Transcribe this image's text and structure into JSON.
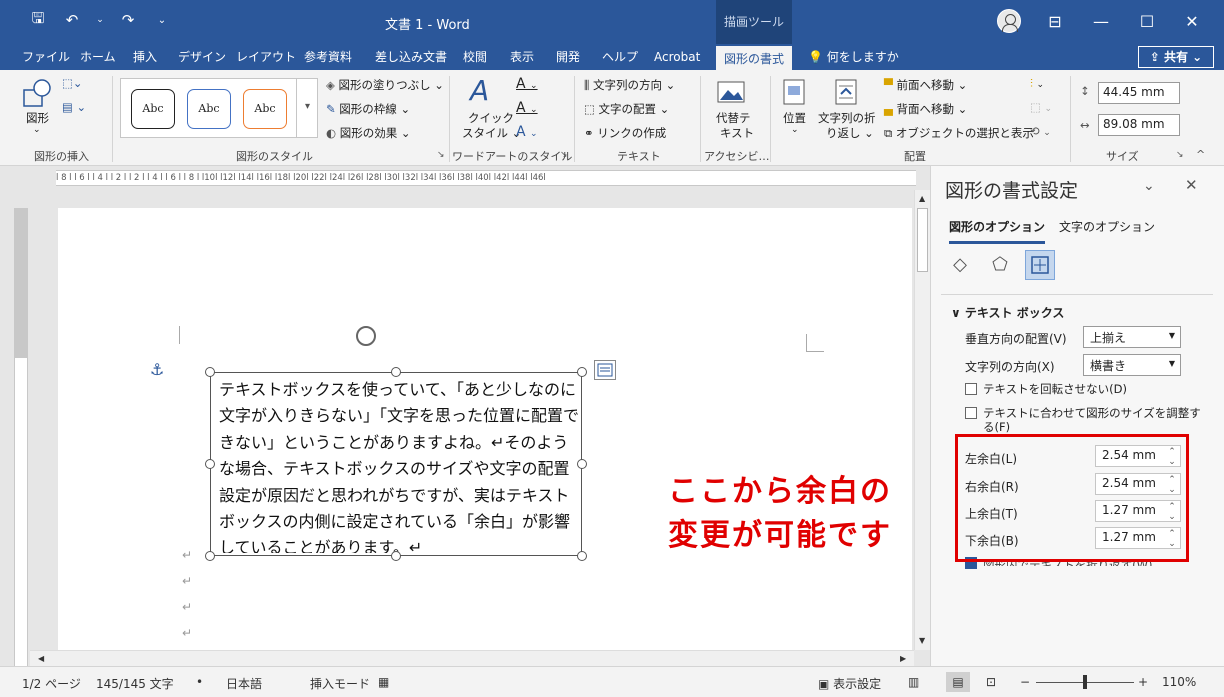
{
  "titlebar": {
    "doc_title": "文書 1  -  Word",
    "context_tab": "描画ツール",
    "icons": [
      "save-icon",
      "undo-icon",
      "redo-icon",
      "customize-qat-icon",
      "ribbon-display-icon"
    ],
    "colors": {
      "brand": "#2b579a"
    }
  },
  "tabs": {
    "items": [
      "ファイル",
      "ホーム",
      "挿入",
      "デザイン",
      "レイアウト",
      "参考資料",
      "差し込み文書",
      "校閲",
      "表示",
      "開発",
      "ヘルプ",
      "Acrobat",
      "図形の書式"
    ],
    "tell_me": "何をしますか",
    "share": "共有"
  },
  "ribbon": {
    "insert_shapes": {
      "shape_label": "図形",
      "group": "図形の挿入"
    },
    "shape_styles": {
      "samples": [
        "Abc",
        "Abc",
        "Abc"
      ],
      "fill": "図形の塗りつぶし",
      "outline": "図形の枠線",
      "effects": "図形の効果",
      "group": "図形のスタイル"
    },
    "wordart": {
      "quick_styles_line1": "クイック",
      "quick_styles_line2": "スタイル",
      "group": "ワードアートのスタイル"
    },
    "text": {
      "direction": "文字列の方向",
      "align": "文字の配置",
      "link": "リンクの作成",
      "group": "テキスト"
    },
    "accessibility": {
      "alt_text_line1": "代替テ",
      "alt_text_line2": "キスト",
      "group": "アクセシビ…"
    },
    "arrange": {
      "position": "位置",
      "wrap_line1": "文字列の折",
      "wrap_line2": "り返し",
      "bring_forward": "前面へ移動",
      "send_backward": "背面へ移動",
      "selection_pane": "オブジェクトの選択と表示",
      "group": "配置"
    },
    "size": {
      "height": "44.45 mm",
      "width": "89.08 mm",
      "group": "サイズ"
    }
  },
  "ruler": {
    "ticks": "l 8 l  l 6 l  l 4 l  l 2 l     l 2 l  l 4 l  l 6 l  l 8 l  l10l  l12l  l14l  l16l  l18l  l20l  l22l  l24l  l26l  l28l  l30l  l32l  l34l  l36l  l38l  l40l  l42l  l44l  l46l"
  },
  "document": {
    "textbox_text": "テキストボックスを使っていて、「あと少しなのに文字が入りきらない」「文字を思った位置に配置できない」ということがありますよね。↵そのような場合、テキストボックスのサイズや文字の配置設定が原因だと思われがちですが、実はテキストボックスの内側に設定されている「余白」が影響していることがあります。↵",
    "para_marks": [
      "↵",
      "↵",
      "↵",
      "↵"
    ],
    "annotation_line1": "ここから余白の",
    "annotation_line2": "変更が可能です"
  },
  "pane": {
    "title": "図形の書式設定",
    "tab_shape": "図形のオプション",
    "tab_text": "文字のオプション",
    "section": "テキスト ボックス",
    "vertical_align_label": "垂直方向の配置(V)",
    "vertical_align_value": "上揃え",
    "text_direction_label": "文字列の方向(X)",
    "text_direction_value": "横書き",
    "no_rotate_label": "テキストを回転させない(D)",
    "autofit_label": "テキストに合わせて図形のサイズを調整する(F)",
    "left_label": "左余白(L)",
    "left_value": "2.54 mm",
    "right_label": "右余白(R)",
    "right_value": "2.54 mm",
    "top_label": "上余白(T)",
    "top_value": "1.27 mm",
    "bottom_label": "下余白(B)",
    "bottom_value": "1.27 mm",
    "wrap_label": "図形内でテキストを折り返す(W)",
    "highlight_color": "#e00000"
  },
  "status": {
    "page": "1/2 ページ",
    "words": "145/145 文字",
    "language": "日本語",
    "mode": "挿入モード",
    "display_settings": "表示設定",
    "zoom": "110%"
  }
}
